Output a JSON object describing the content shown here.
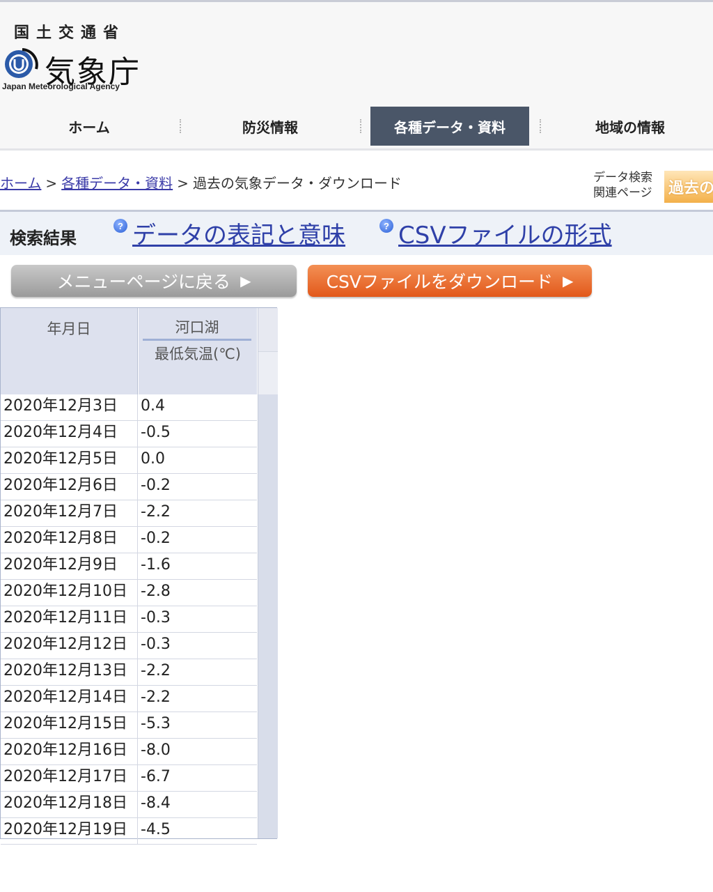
{
  "header": {
    "ministry": "国土交通省",
    "agency_jp": "気象庁",
    "agency_en": "Japan Meteorological Agency"
  },
  "nav": {
    "items": [
      {
        "label": "ホーム"
      },
      {
        "label": "防災情報"
      },
      {
        "label": "各種データ・資料"
      },
      {
        "label": "地域の情報"
      }
    ]
  },
  "breadcrumb": {
    "home": "ホーム",
    "data": "各種データ・資料",
    "current": "過去の気象データ・ダウンロード",
    "sep": ">"
  },
  "side": {
    "label": "データ検索関連ページ",
    "banner": "過去の"
  },
  "result": {
    "title": "検索結果",
    "help1": "データの表記と意味",
    "help2": "CSVファイルの形式",
    "help_icon": "?"
  },
  "buttons": {
    "menu": "メニューページに戻る",
    "csv": "CSVファイルをダウンロード",
    "arrow": "▶"
  },
  "table": {
    "date_header": "年月日",
    "station": "河口湖",
    "item": "最低気温(℃)",
    "rows": [
      {
        "date": "2020年12月3日",
        "value": "0.4"
      },
      {
        "date": "2020年12月4日",
        "value": "-0.5"
      },
      {
        "date": "2020年12月5日",
        "value": "0.0"
      },
      {
        "date": "2020年12月6日",
        "value": "-0.2"
      },
      {
        "date": "2020年12月7日",
        "value": "-2.2"
      },
      {
        "date": "2020年12月8日",
        "value": "-0.2"
      },
      {
        "date": "2020年12月9日",
        "value": "-1.6"
      },
      {
        "date": "2020年12月10日",
        "value": "-2.8"
      },
      {
        "date": "2020年12月11日",
        "value": "-0.3"
      },
      {
        "date": "2020年12月12日",
        "value": "-0.3"
      },
      {
        "date": "2020年12月13日",
        "value": "-2.2"
      },
      {
        "date": "2020年12月14日",
        "value": "-2.2"
      },
      {
        "date": "2020年12月15日",
        "value": "-5.3"
      },
      {
        "date": "2020年12月16日",
        "value": "-8.0"
      },
      {
        "date": "2020年12月17日",
        "value": "-6.7"
      },
      {
        "date": "2020年12月18日",
        "value": "-8.4"
      },
      {
        "date": "2020年12月19日",
        "value": "-4.5"
      }
    ]
  },
  "colors": {
    "nav_active": "#4a5668",
    "link": "#3b3ba8",
    "csv_button": "#e2581a",
    "menu_button": "#9a9a9a"
  }
}
